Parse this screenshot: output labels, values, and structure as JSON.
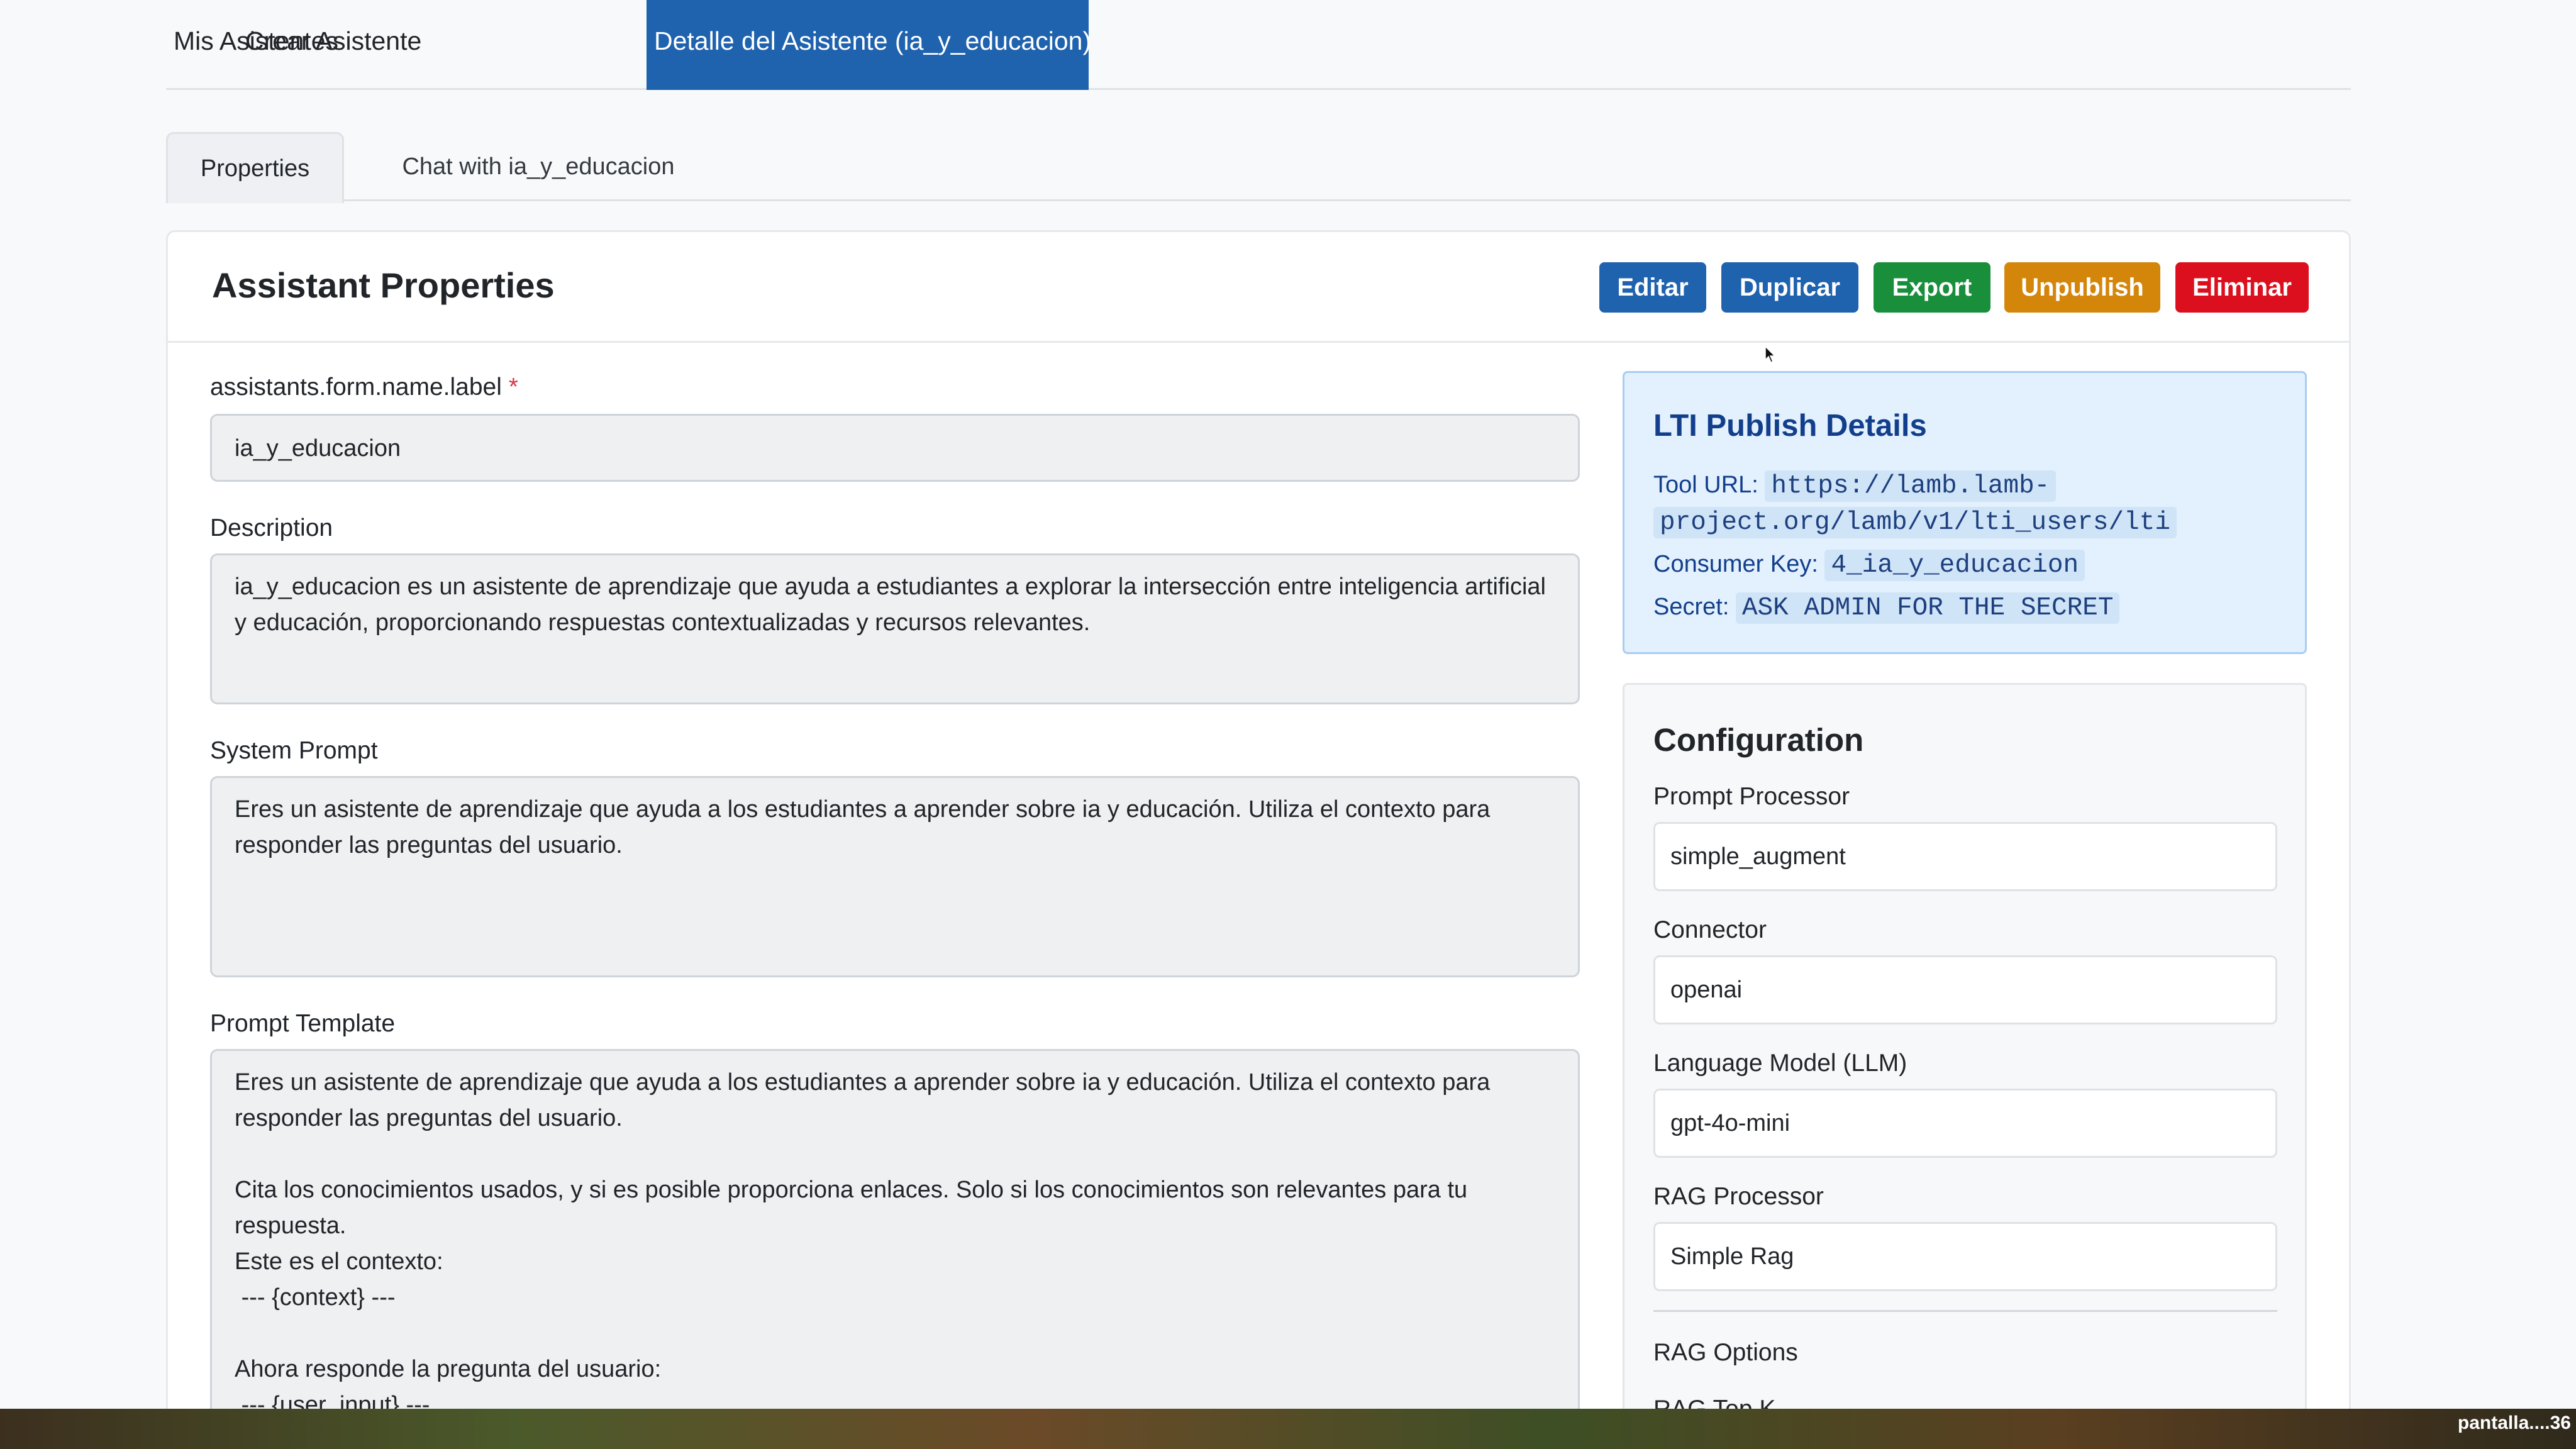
{
  "topnav": {
    "items": [
      {
        "label": "Mis Asistentes"
      },
      {
        "label": "Crear Asistente"
      },
      {
        "label": "Detalle del Asistente (ia_y_educacion)"
      }
    ]
  },
  "subtabs": [
    {
      "label": "Properties"
    },
    {
      "label": "Chat with ia_y_educacion"
    }
  ],
  "card": {
    "title": "Assistant Properties",
    "buttons": {
      "edit": "Editar",
      "duplicate": "Duplicar",
      "export": "Export",
      "unpublish": "Unpublish",
      "delete": "Eliminar"
    },
    "button_colors": {
      "edit": "#1f62ae",
      "duplicate": "#1f62ae",
      "export": "#198f3c",
      "unpublish": "#d4860b",
      "delete": "#dc0f1e"
    }
  },
  "form": {
    "name_label": "assistants.form.name.label",
    "required_mark": "*",
    "name_value": "ia_y_educacion",
    "description_label": "Description",
    "description_value": "ia_y_educacion es un asistente de aprendizaje que ayuda a estudiantes a explorar la intersección entre inteligencia artificial y educación, proporcionando respuestas contextualizadas y recursos relevantes.",
    "system_prompt_label": "System Prompt",
    "system_prompt_value": "Eres un asistente de aprendizaje que ayuda a los estudiantes a aprender sobre ia y educación. Utiliza el contexto para responder las preguntas del usuario.",
    "prompt_template_label": "Prompt Template",
    "prompt_template_value": "Eres un asistente de aprendizaje que ayuda a los estudiantes a aprender sobre ia y educación. Utiliza el contexto para responder las preguntas del usuario.\n\nCita los conocimientos usados, y si es posible proporciona enlaces. Solo si los conocimientos son relevantes para tu respuesta.\nEste es el contexto:\n --- {context} ---\n\nAhora responde la pregunta del usuario:\n --- {user_input} ---"
  },
  "lti": {
    "title": "LTI Publish Details",
    "tool_url_label": "Tool URL:",
    "tool_url_line1": "https://lamb.lamb-",
    "tool_url_line2": "project.org/lamb/v1/lti_users/lti",
    "consumer_key_label": "Consumer Key:",
    "consumer_key_value": "4_ia_y_educacion",
    "secret_label": "Secret:",
    "secret_value": "ASK ADMIN FOR THE SECRET"
  },
  "config": {
    "title": "Configuration",
    "fields": [
      {
        "label": "Prompt Processor",
        "value": "simple_augment"
      },
      {
        "label": "Connector",
        "value": "openai"
      },
      {
        "label": "Language Model (LLM)",
        "value": "gpt-4o-mini"
      },
      {
        "label": "RAG Processor",
        "value": "Simple Rag"
      }
    ],
    "rag_options_label": "RAG Options",
    "rag_top_k_label": "RAG Top K"
  },
  "overlay": {
    "corner_text": "pantalla....36"
  }
}
